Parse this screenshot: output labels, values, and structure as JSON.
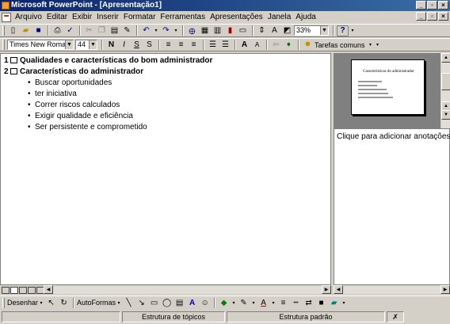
{
  "window": {
    "title": "Microsoft PowerPoint - [Apresentação1]",
    "min": "_",
    "max": "▫",
    "close": "×"
  },
  "menu": [
    "Arquivo",
    "Editar",
    "Exibir",
    "Inserir",
    "Formatar",
    "Ferramentas",
    "Apresentações",
    "Janela",
    "Ajuda"
  ],
  "toolbar": {
    "zoom": "33%",
    "help": "?"
  },
  "format": {
    "font": "Times New Roman",
    "size": "44",
    "bold": "N",
    "italic": "I",
    "underline": "S",
    "shadow": "S",
    "tasks": "Tarefas comuns"
  },
  "outline": {
    "slides": [
      {
        "number": "1",
        "title": "Qualidades e características do bom administrador",
        "bullets": []
      },
      {
        "number": "2",
        "title": "Características do administrador",
        "bullets": [
          "Buscar oportunidades",
          "ter iniciativa",
          "Correr riscos calculados",
          "Exigir qualidade e eficiência",
          "Ser persistente e comprometido"
        ]
      }
    ]
  },
  "thumbnail": {
    "title": "Características do administrador"
  },
  "notes": {
    "placeholder": "Clique para adicionar anotações"
  },
  "drawing": {
    "draw": "Desenhar",
    "autoshapes": "AutoFormas"
  },
  "status": {
    "view": "Estrutura de tópicos",
    "design": "Estrutura padrão"
  },
  "colors": {
    "titlebar": "#0a246a",
    "thumbbg": "#808080"
  }
}
